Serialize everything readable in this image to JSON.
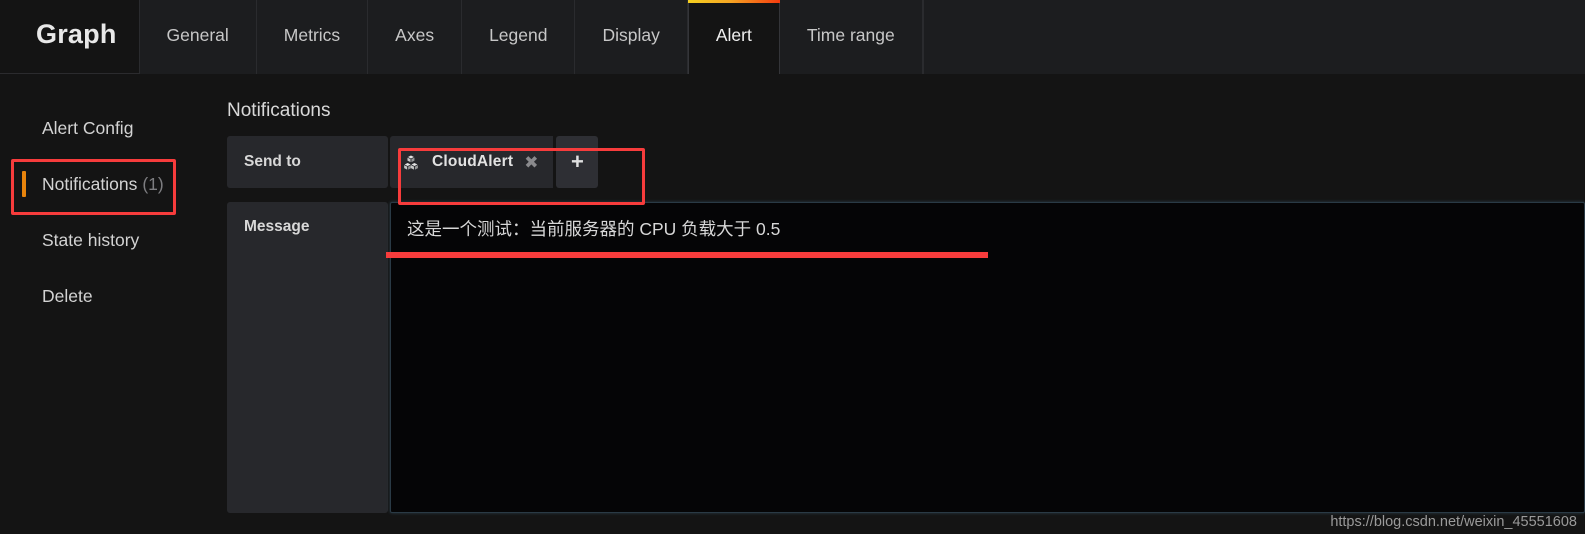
{
  "header": {
    "panel_title": "Graph",
    "tabs": [
      {
        "label": "General",
        "active": false
      },
      {
        "label": "Metrics",
        "active": false
      },
      {
        "label": "Axes",
        "active": false
      },
      {
        "label": "Legend",
        "active": false
      },
      {
        "label": "Display",
        "active": false
      },
      {
        "label": "Alert",
        "active": true
      },
      {
        "label": "Time range",
        "active": false
      }
    ],
    "active_tab_accent_from": "#f5d020",
    "active_tab_accent_to": "#f53b0e"
  },
  "sidebar": {
    "items": [
      {
        "label": "Alert Config",
        "badge": "",
        "active": false
      },
      {
        "label": "Notifications",
        "badge": "(1)",
        "active": true
      },
      {
        "label": "State history",
        "badge": "",
        "active": false
      },
      {
        "label": "Delete",
        "badge": "",
        "active": false
      }
    ],
    "active_accent_color": "#e8840c"
  },
  "main": {
    "section_title": "Notifications",
    "send_to": {
      "label": "Send to",
      "tags": [
        {
          "name": "CloudAlert",
          "icon": "cubes-icon",
          "remove_label": "✖"
        }
      ],
      "add_button_label": "+"
    },
    "message": {
      "label": "Message",
      "value": "这是一个测试：当前服务器的 CPU 负载大于 0.5",
      "placeholder": ""
    }
  },
  "annotations": {
    "color": "#f73c3c",
    "highlight_notifications": "Notifications (1)",
    "highlight_send_to": "CloudAlert tag and add button",
    "underline_message": "这是一个测试：当前服务器的 CPU 负载大于 0.5"
  },
  "watermark": {
    "text": "https://blog.csdn.net/weixin_45551608"
  }
}
